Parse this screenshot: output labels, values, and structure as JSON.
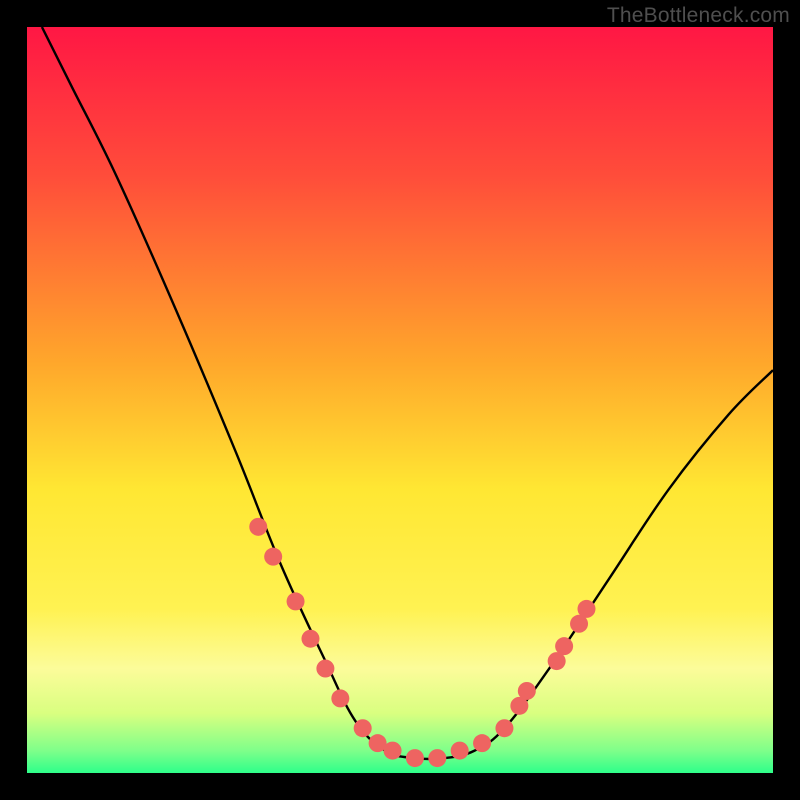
{
  "watermark": "TheBottleneck.com",
  "chart_data": {
    "type": "line",
    "title": "",
    "xlabel": "",
    "ylabel": "",
    "xlim": [
      0,
      100
    ],
    "ylim": [
      0,
      100
    ],
    "gradient_stops": [
      {
        "offset": 0,
        "color": "#ff1744"
      },
      {
        "offset": 20,
        "color": "#ff4d3a"
      },
      {
        "offset": 45,
        "color": "#ffa72b"
      },
      {
        "offset": 62,
        "color": "#ffe733"
      },
      {
        "offset": 78,
        "color": "#fff252"
      },
      {
        "offset": 86,
        "color": "#fcfc9a"
      },
      {
        "offset": 92,
        "color": "#d9ff80"
      },
      {
        "offset": 97,
        "color": "#7fff8a"
      },
      {
        "offset": 100,
        "color": "#2eff8a"
      }
    ],
    "series": [
      {
        "name": "bottleneck-curve",
        "color": "#000000",
        "points": [
          {
            "x": 2,
            "y": 100
          },
          {
            "x": 6,
            "y": 92
          },
          {
            "x": 12,
            "y": 80
          },
          {
            "x": 20,
            "y": 62
          },
          {
            "x": 28,
            "y": 43
          },
          {
            "x": 34,
            "y": 28
          },
          {
            "x": 40,
            "y": 15
          },
          {
            "x": 44,
            "y": 7
          },
          {
            "x": 48,
            "y": 3
          },
          {
            "x": 52,
            "y": 2
          },
          {
            "x": 56,
            "y": 2
          },
          {
            "x": 60,
            "y": 3
          },
          {
            "x": 64,
            "y": 6
          },
          {
            "x": 70,
            "y": 14
          },
          {
            "x": 78,
            "y": 26
          },
          {
            "x": 86,
            "y": 38
          },
          {
            "x": 94,
            "y": 48
          },
          {
            "x": 100,
            "y": 54
          }
        ]
      }
    ],
    "markers": {
      "name": "highlight-dots",
      "color": "#ee6461",
      "radius_px": 9,
      "points": [
        {
          "x": 31,
          "y": 33
        },
        {
          "x": 33,
          "y": 29
        },
        {
          "x": 36,
          "y": 23
        },
        {
          "x": 38,
          "y": 18
        },
        {
          "x": 40,
          "y": 14
        },
        {
          "x": 42,
          "y": 10
        },
        {
          "x": 45,
          "y": 6
        },
        {
          "x": 47,
          "y": 4
        },
        {
          "x": 49,
          "y": 3
        },
        {
          "x": 52,
          "y": 2
        },
        {
          "x": 55,
          "y": 2
        },
        {
          "x": 58,
          "y": 3
        },
        {
          "x": 61,
          "y": 4
        },
        {
          "x": 64,
          "y": 6
        },
        {
          "x": 66,
          "y": 9
        },
        {
          "x": 67,
          "y": 11
        },
        {
          "x": 71,
          "y": 15
        },
        {
          "x": 72,
          "y": 17
        },
        {
          "x": 74,
          "y": 20
        },
        {
          "x": 75,
          "y": 22
        }
      ]
    }
  }
}
